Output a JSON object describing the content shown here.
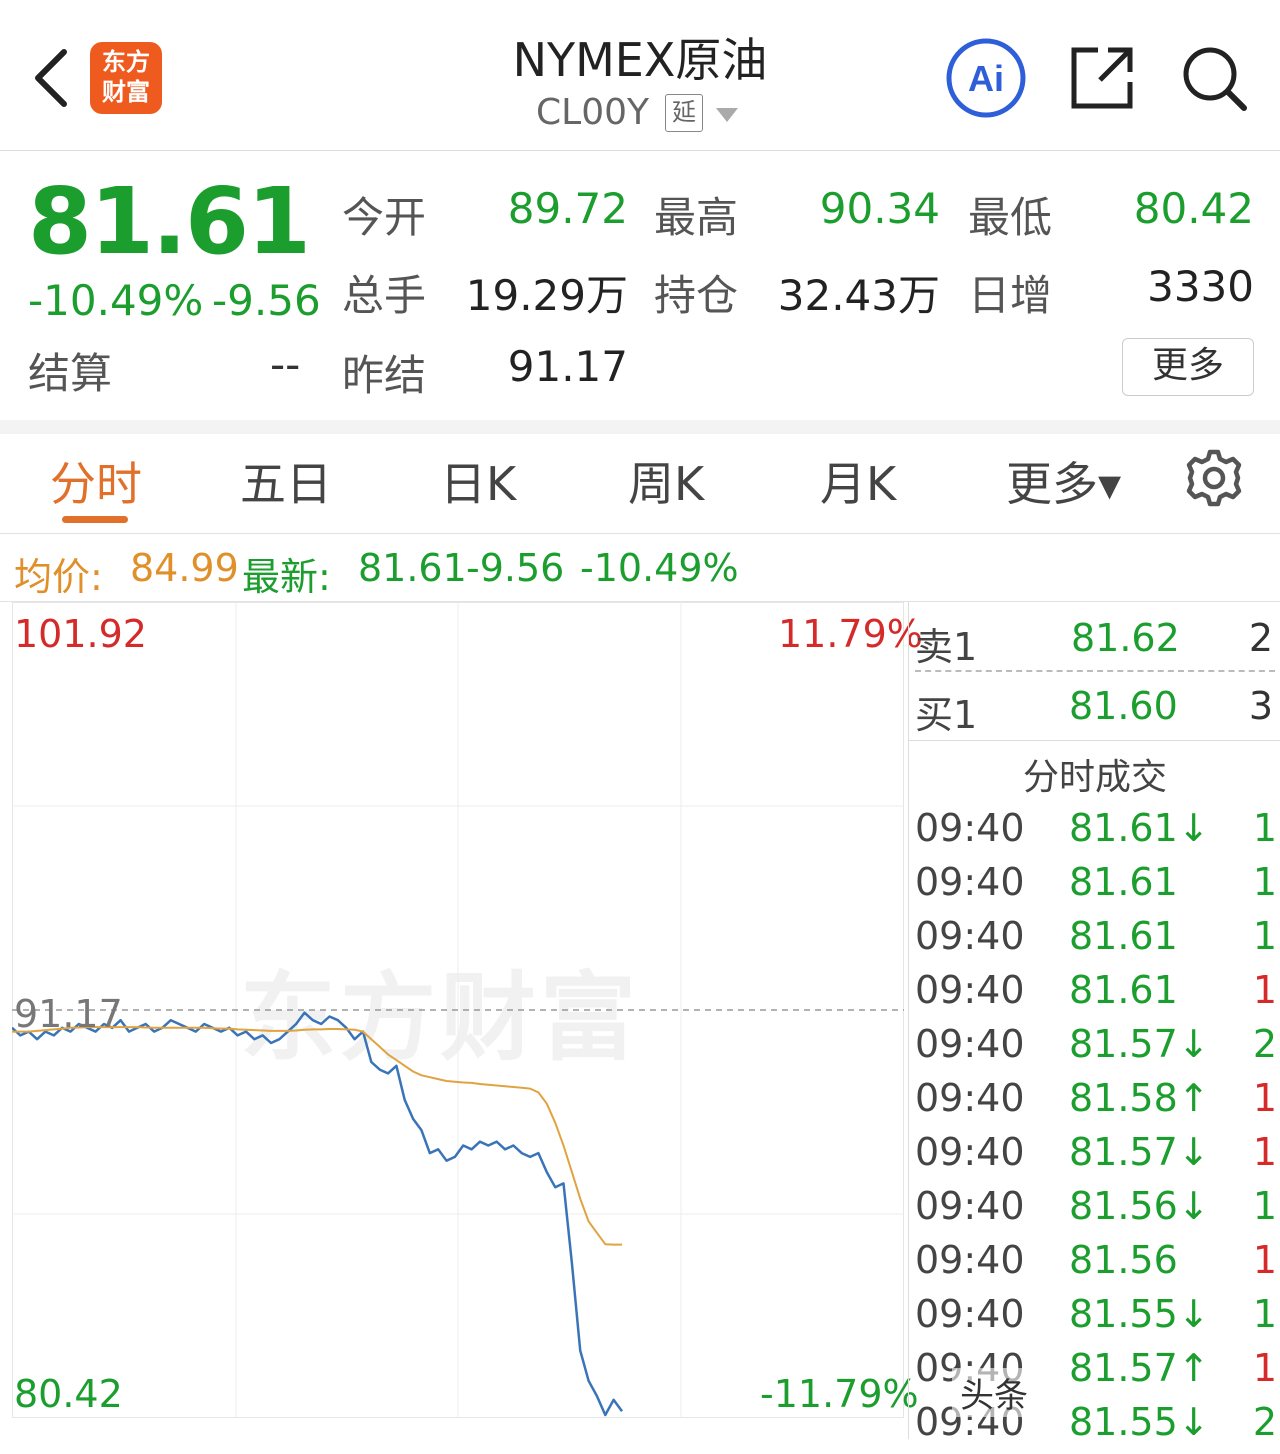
{
  "header": {
    "back_icon": "chevron-left-icon",
    "logo_line1": "东方",
    "logo_line2": "财富",
    "title": "NYMEX原油",
    "code": "CL00Y",
    "delay_badge": "延",
    "dropdown_icon": "caret-down-icon",
    "ai_label": "Ai",
    "share_icon": "share-icon",
    "search_icon": "search-icon"
  },
  "quote": {
    "price": "81.61",
    "change_pct": "-10.49%",
    "change": "-9.56",
    "settle_label": "结算",
    "settle_value": "--",
    "fields": [
      {
        "label": "今开",
        "value": "89.72",
        "color": "green"
      },
      {
        "label": "最高",
        "value": "90.34",
        "color": "green"
      },
      {
        "label": "最低",
        "value": "80.42",
        "color": "green"
      },
      {
        "label": "总手",
        "value": "19.29万",
        "color": "plain"
      },
      {
        "label": "持仓",
        "value": "32.43万",
        "color": "plain"
      },
      {
        "label": "日增",
        "value": "3330",
        "color": "plain"
      },
      {
        "label": "昨结",
        "value": "91.17",
        "color": "plain"
      }
    ],
    "more_button": "更多"
  },
  "tabs": [
    {
      "label": "分时",
      "active": true
    },
    {
      "label": "五日",
      "active": false
    },
    {
      "label": "日K",
      "active": false
    },
    {
      "label": "周K",
      "active": false
    },
    {
      "label": "月K",
      "active": false
    },
    {
      "label": "更多▾",
      "active": false
    }
  ],
  "settings_icon": "gear-icon",
  "info_line": {
    "avg_label": "均价:",
    "avg_value": "84.99",
    "latest_label": "最新:",
    "latest_value": "81.61",
    "change": "-9.56",
    "change_pct": "-10.49%"
  },
  "chart_labels": {
    "top_left": "101.92",
    "top_right": "11.79%",
    "mid_left": "91.17",
    "bottom_left": "80.42",
    "bottom_right": "-11.79%",
    "watermark": "东方财富"
  },
  "chart_data": {
    "type": "line",
    "ylim": [
      80.42,
      101.92
    ],
    "reference_price": 91.17,
    "series": [
      {
        "values": [
          90.7,
          90.5,
          90.6,
          90.4,
          90.6,
          90.5,
          90.7,
          90.6,
          90.8,
          90.7,
          90.6,
          90.8,
          90.7,
          90.9,
          90.6,
          90.7,
          90.8,
          90.6,
          90.7,
          90.9,
          90.8,
          90.7,
          90.6,
          90.8,
          90.7,
          90.6,
          90.7,
          90.5,
          90.6,
          90.4,
          90.5,
          90.3,
          90.4,
          90.6,
          90.8,
          91.1,
          90.9,
          90.8,
          91.0,
          90.9,
          90.7,
          90.4,
          90.6,
          89.8,
          89.6,
          89.5,
          89.7,
          88.8,
          88.3,
          88.0,
          87.4,
          87.5,
          87.2,
          87.3,
          87.6,
          87.5,
          87.7,
          87.6,
          87.7,
          87.5,
          87.6,
          87.4,
          87.3,
          87.4,
          86.9,
          86.5,
          86.6,
          84.5,
          82.2,
          81.4,
          81.0,
          80.5,
          80.9,
          80.6
        ],
        "color": "#3a74b8"
      },
      {
        "values": [
          90.6,
          90.6,
          90.6,
          90.62,
          90.64,
          90.66,
          90.68,
          90.7,
          90.71,
          90.72,
          90.72,
          90.72,
          90.72,
          90.72,
          90.72,
          90.72,
          90.71,
          90.7,
          90.7,
          90.7,
          90.7,
          90.7,
          90.7,
          90.7,
          90.69,
          90.68,
          90.68,
          90.66,
          90.65,
          90.64,
          90.63,
          90.62,
          90.62,
          90.62,
          90.63,
          90.65,
          90.66,
          90.66,
          90.67,
          90.67,
          90.66,
          90.65,
          90.6,
          90.4,
          90.2,
          90.0,
          89.85,
          89.7,
          89.55,
          89.45,
          89.4,
          89.35,
          89.3,
          89.28,
          89.26,
          89.25,
          89.22,
          89.2,
          89.18,
          89.16,
          89.14,
          89.12,
          89.1,
          89.0,
          88.7,
          88.2,
          87.6,
          86.9,
          86.2,
          85.6,
          85.3,
          85.0,
          84.99,
          84.99
        ],
        "color": "#e0a340"
      }
    ]
  },
  "orderbook": {
    "sell": {
      "label": "卖1",
      "price": "81.62",
      "volume": "2"
    },
    "buy": {
      "label": "买1",
      "price": "81.60",
      "volume": "3"
    }
  },
  "ticks_title": "分时成交",
  "ticks": [
    {
      "time": "09:40",
      "price": "81.61↓",
      "vol": "1",
      "price_color": "green",
      "vol_color": "green"
    },
    {
      "time": "09:40",
      "price": "81.61",
      "vol": "1",
      "price_color": "green",
      "vol_color": "green"
    },
    {
      "time": "09:40",
      "price": "81.61",
      "vol": "1",
      "price_color": "green",
      "vol_color": "green"
    },
    {
      "time": "09:40",
      "price": "81.61",
      "vol": "1",
      "price_color": "green",
      "vol_color": "red"
    },
    {
      "time": "09:40",
      "price": "81.57↓",
      "vol": "2",
      "price_color": "green",
      "vol_color": "green"
    },
    {
      "time": "09:40",
      "price": "81.58↑",
      "vol": "1",
      "price_color": "green",
      "vol_color": "red"
    },
    {
      "time": "09:40",
      "price": "81.57↓",
      "vol": "1",
      "price_color": "green",
      "vol_color": "red"
    },
    {
      "time": "09:40",
      "price": "81.56↓",
      "vol": "1",
      "price_color": "green",
      "vol_color": "green"
    },
    {
      "time": "09:40",
      "price": "81.56",
      "vol": "1",
      "price_color": "green",
      "vol_color": "red"
    },
    {
      "time": "09:40",
      "price": "81.55↓",
      "vol": "1",
      "price_color": "green",
      "vol_color": "green"
    },
    {
      "time": "09:40",
      "price": "81.57↑",
      "vol": "1",
      "price_color": "green",
      "vol_color": "red"
    },
    {
      "time": "09:40",
      "price": "81.55↓",
      "vol": "2",
      "price_color": "green",
      "vol_color": "green"
    }
  ],
  "footer_watermark": "头条"
}
